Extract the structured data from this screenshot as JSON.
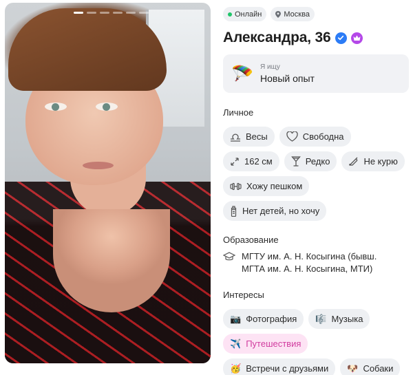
{
  "photo": {
    "alt": "profile photo",
    "indicator_count": 6,
    "active_index": 0
  },
  "status": {
    "online": "Онлайн",
    "city": "Москва"
  },
  "profile": {
    "name": "Александра, 36"
  },
  "seeking": {
    "label": "Я ищу",
    "value": "Новый опыт",
    "emoji": "🪂"
  },
  "personal": {
    "title": "Личное",
    "chips": [
      {
        "icon": "zodiac-libra-icon",
        "label": "Весы"
      },
      {
        "icon": "heart-icon",
        "label": "Свободна"
      },
      {
        "icon": "height-arrows-icon",
        "label": "162 см"
      },
      {
        "icon": "glass-icon",
        "label": "Редко"
      },
      {
        "icon": "no-smoking-icon",
        "label": "Не курю"
      },
      {
        "icon": "dumbbell-icon",
        "label": "Хожу пешком"
      },
      {
        "icon": "baby-bottle-icon",
        "label": "Нет детей, но хочу"
      }
    ]
  },
  "education": {
    "title": "Образование",
    "line1": "МГТУ им. А. Н. Косыгина (бывш.",
    "line2": "МГТА им. А. Н. Косыгина, МТИ)"
  },
  "interests": {
    "title": "Интересы",
    "chips": [
      {
        "emoji": "📷",
        "label": "Фотография"
      },
      {
        "emoji": "🎼",
        "label": "Музыка"
      },
      {
        "emoji": "✈️",
        "label": "Путешествия",
        "highlight": true
      },
      {
        "emoji": "🥳",
        "label": "Встречи с друзьями"
      },
      {
        "emoji": "🐶",
        "label": "Собаки"
      }
    ]
  },
  "colors": {
    "online": "#20c56a",
    "verified": "#2c7cf6",
    "premium": "#b448e8",
    "highlight_text": "#d13c9f",
    "highlight_bg": "#fde3f4",
    "chip_bg": "#eef0f3"
  }
}
